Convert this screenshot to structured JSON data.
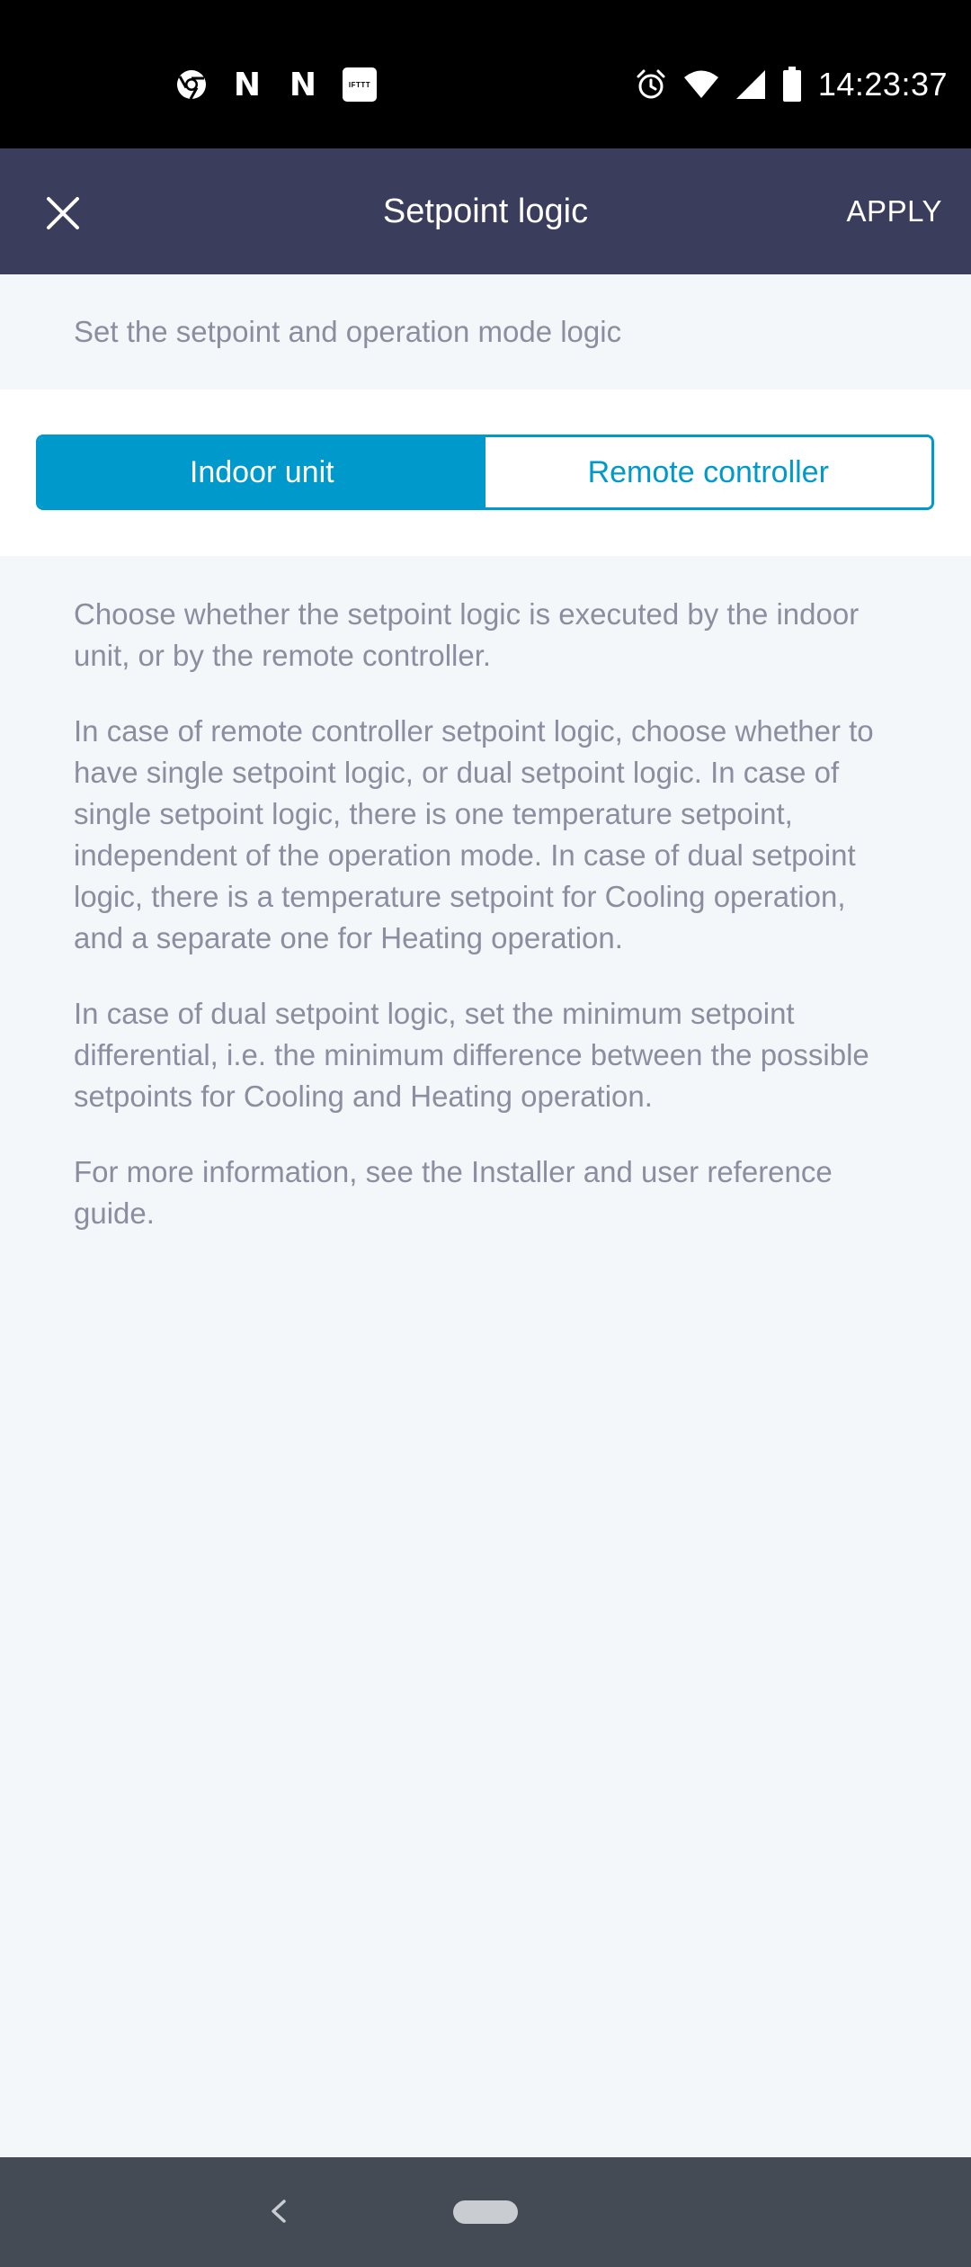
{
  "status_bar": {
    "time": "14:23:37",
    "left_icons": [
      "chrome-icon",
      "n-icon",
      "n-icon",
      "ifttt-icon"
    ],
    "n_letter": "N",
    "ifttt_label": "IFTTT",
    "right_icons": [
      "alarm-icon",
      "wifi-icon",
      "signal-icon",
      "battery-icon"
    ]
  },
  "header": {
    "title": "Setpoint logic",
    "apply_label": "APPLY",
    "close_icon": "close-icon",
    "background": "#3b3d5c"
  },
  "subtitle": "Set the setpoint and operation mode logic",
  "segmented_control": {
    "options": [
      "Indoor unit",
      "Remote controller"
    ],
    "selected": "Indoor unit",
    "accent_color": "#0099cc"
  },
  "description": {
    "paragraphs": [
      "Choose whether the setpoint logic is executed by the indoor unit, or by the remote controller.",
      "In case of remote controller setpoint logic, choose whether to have single setpoint logic, or dual setpoint logic. In case of single setpoint logic, there is one temperature setpoint, independent of the operation mode. In case of dual setpoint logic, there is a temperature setpoint for Cooling operation, and a separate one for Heating operation.",
      "In case of dual setpoint logic, set the minimum setpoint differential, i.e. the minimum difference between the possible setpoints for Cooling and Heating operation.",
      "For more information, see the Installer and user reference guide."
    ]
  },
  "nav_bar": {
    "back_icon": "chevron-left-icon",
    "home_icon": "home-pill-icon"
  }
}
